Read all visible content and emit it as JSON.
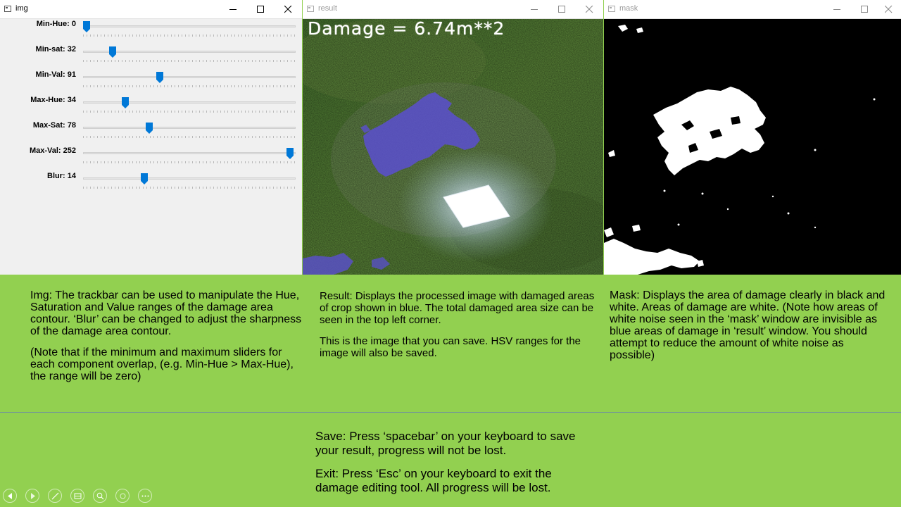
{
  "windows": {
    "img": {
      "title": "img"
    },
    "result": {
      "title": "result"
    },
    "mask": {
      "title": "mask"
    }
  },
  "trackbars": [
    {
      "label": "Min-Hue: 0",
      "value": 0,
      "max": 179
    },
    {
      "label": "Min-sat: 32",
      "value": 32,
      "max": 255
    },
    {
      "label": "Min-Val: 91",
      "value": 91,
      "max": 255
    },
    {
      "label": "Max-Hue: 34",
      "value": 34,
      "max": 179
    },
    {
      "label": "Max-Sat: 78",
      "value": 78,
      "max": 255
    },
    {
      "label": "Max-Val: 252",
      "value": 252,
      "max": 255
    },
    {
      "label": "Blur: 14",
      "value": 14,
      "max": 50
    }
  ],
  "result": {
    "damage_text": "Damage = 6.74m**2"
  },
  "descriptions": {
    "img": {
      "p1": "Img: The trackbar can be used to manipulate the Hue, Saturation and Value ranges of the damage area contour. ‘Blur’ can be changed to adjust the sharpness of the damage area contour.",
      "p2": "(Note that if the minimum and maximum sliders for each component overlap, (e.g. Min-Hue > Max-Hue), the range will be zero)"
    },
    "result": {
      "p1": "Result: Displays the processed image with damaged areas of crop shown in blue. The total damaged area size can be seen in the top left corner.",
      "p2": "This is the image that you can save. HSV ranges for the image will also be saved."
    },
    "mask": {
      "p1": "Mask: Displays the area of damage clearly in black and white. Areas of damage are white. (Note how areas of white noise seen in the ‘mask’ window are invisible as blue areas of damage in ‘result’ window. You should attempt to reduce the amount of white noise as possible)"
    },
    "save": "Save: Press ‘spacebar’ on your keyboard to save your result, progress will not be lost.",
    "exit": "Exit: Press ‘Esc’ on your keyboard to exit the damage editing tool. All progress will be lost."
  },
  "colors": {
    "slide_background": "#92d050",
    "thumb": "#0078d7",
    "damage_overlay": "#5a4fd0"
  },
  "icons": [
    "back-icon",
    "forward-icon",
    "pen-icon",
    "slides-icon",
    "zoom-icon",
    "circle-icon",
    "more-icon"
  ]
}
